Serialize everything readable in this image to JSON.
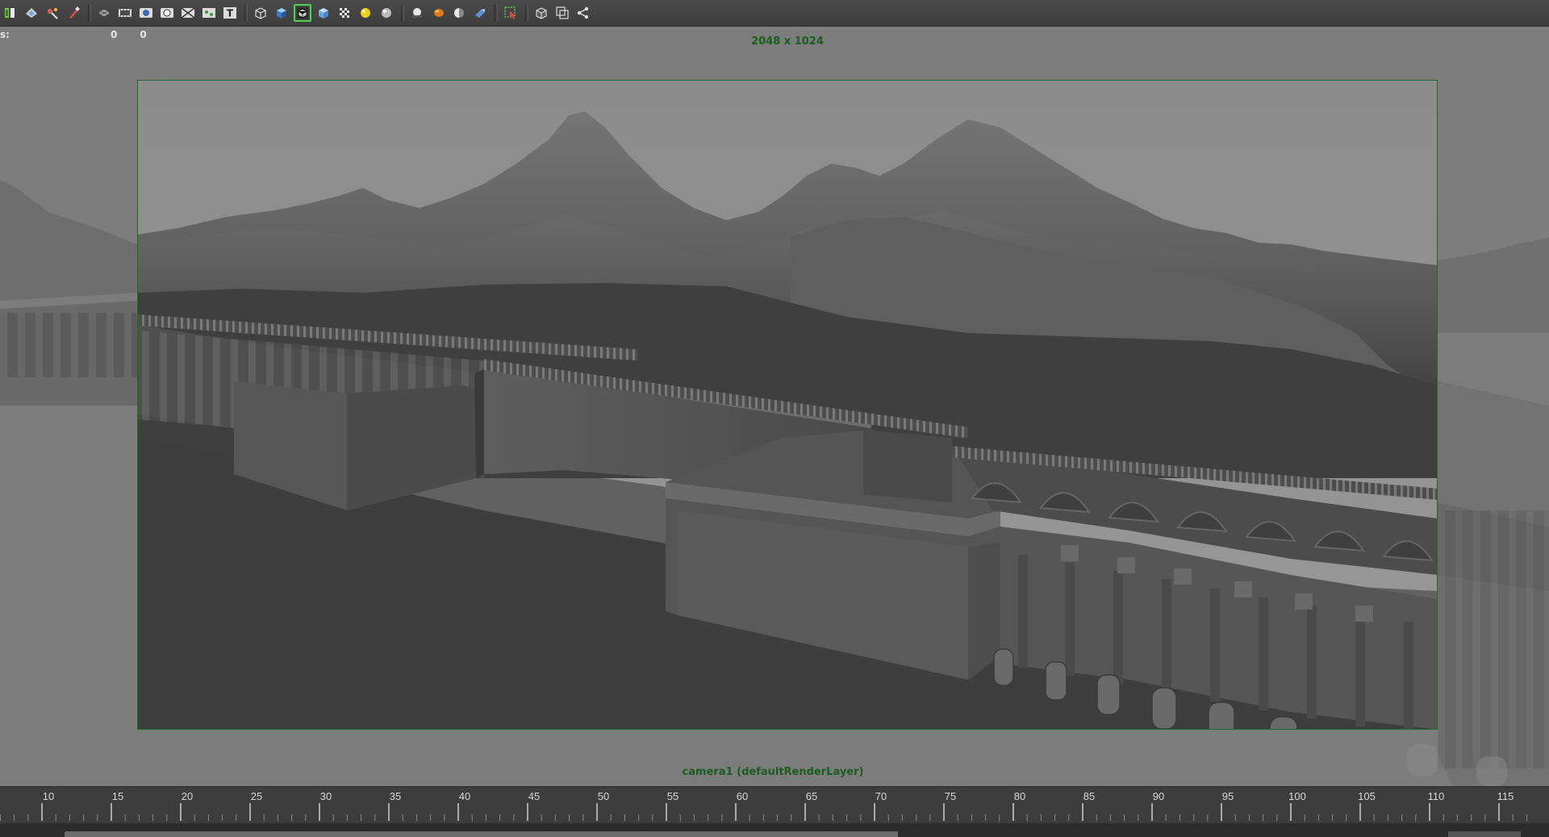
{
  "toolbar": {
    "icons": [
      "isolate-select-icon",
      "camera-attributes-icon",
      "snap-icon",
      "paint-tool-icon",
      "separator",
      "grid-icon",
      "film-gate-icon",
      "resolution-gate-icon",
      "gate-mask-icon",
      "field-chart-icon",
      "safe-action-icon",
      "safe-title-icon",
      "separator",
      "wireframe-icon",
      "smooth-shade-icon",
      "wireframe-on-shaded-icon",
      "default-material-icon",
      "textured-icon",
      "use-all-lights-icon",
      "shadows-icon",
      "separator",
      "screen-space-ao-icon",
      "motion-blur-icon",
      "multisample-aa-icon",
      "depth-of-field-icon",
      "separator",
      "select-camera-icon",
      "separator",
      "isolate-view-icon",
      "xray-icon",
      "xray-joints-icon"
    ],
    "active_icon": "wireframe-on-shaded-icon",
    "text_icon_glyph": "T"
  },
  "viewport": {
    "hud_label": "s:",
    "hud_values": [
      "0",
      "0"
    ],
    "resolution": "2048 x 1024",
    "camera_label": "camera1 (defaultRenderLayer)",
    "gate_color": "#1e6a24",
    "hud_text_color": "#1b5c20"
  },
  "timeline": {
    "ticks": [
      "10",
      "15",
      "20",
      "25",
      "30",
      "35",
      "40",
      "45",
      "50",
      "55",
      "60",
      "65",
      "70",
      "75",
      "80",
      "85",
      "90",
      "95",
      "100",
      "105",
      "110",
      "115"
    ]
  }
}
